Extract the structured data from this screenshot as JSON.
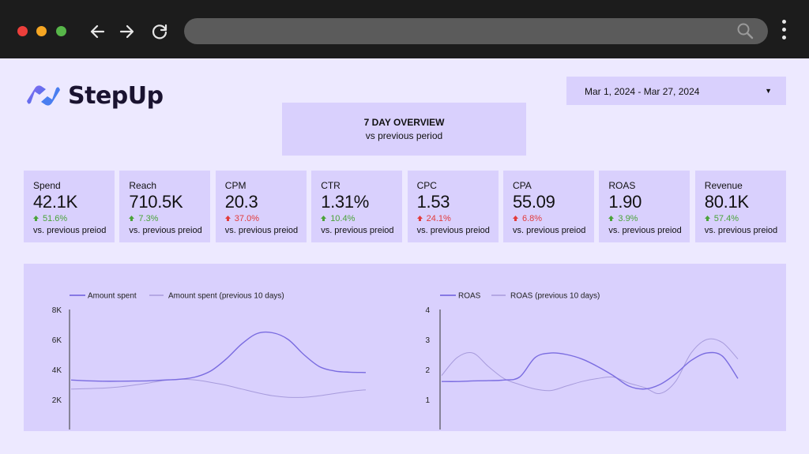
{
  "browser": {
    "icons": [
      "arrow-left-icon",
      "arrow-right-icon",
      "reload-icon",
      "search-icon",
      "kebab-menu-icon"
    ]
  },
  "brand": {
    "name": "StepUp"
  },
  "overview": {
    "title": "7 DAY OVERVIEW",
    "subtitle": "vs previous period"
  },
  "date_range": {
    "value": "Mar 1, 2024 - Mar 27, 2024",
    "arrow": "▼"
  },
  "colors": {
    "accent": "#7a6ce0",
    "panel": "#d9d0fd",
    "background": "#ede9ff",
    "up": "#4aa33a",
    "down": "#e23b3b"
  },
  "kpis": [
    {
      "label": "Spend",
      "value": "42.1K",
      "delta": "51.6%",
      "direction": "up",
      "sub": "vs. previous preiod"
    },
    {
      "label": "Reach",
      "value": "710.5K",
      "delta": "7.3%",
      "direction": "up",
      "sub": "vs. previous preiod"
    },
    {
      "label": "CPM",
      "value": "20.3",
      "delta": "37.0%",
      "direction": "down",
      "sub": "vs. previous preiod"
    },
    {
      "label": "CTR",
      "value": "1.31%",
      "delta": "10.4%",
      "direction": "up",
      "sub": "vs. previous preiod"
    },
    {
      "label": "CPC",
      "value": "1.53",
      "delta": "24.1%",
      "direction": "down",
      "sub": "vs. previous preiod"
    },
    {
      "label": "CPA",
      "value": "55.09",
      "delta": "6.8%",
      "direction": "down",
      "sub": "vs. previous preiod"
    },
    {
      "label": "ROAS",
      "value": "1.90",
      "delta": "3.9%",
      "direction": "up",
      "sub": "vs. previous preiod"
    },
    {
      "label": "Revenue",
      "value": "80.1K",
      "delta": "57.4%",
      "direction": "up",
      "sub": "vs. previous preiod"
    }
  ],
  "chart_data": [
    {
      "type": "line",
      "ylim": [
        0,
        8000
      ],
      "yticks": [
        "2K",
        "4K",
        "6K",
        "8K"
      ],
      "ytick_values": [
        2000,
        4000,
        6000,
        8000
      ],
      "x": [
        1,
        2,
        3,
        4,
        5,
        6,
        7,
        8,
        9,
        10,
        11,
        12,
        13,
        14,
        15,
        16,
        17,
        18,
        19,
        20
      ],
      "series": [
        {
          "name": "Amount spent",
          "values": [
            3300,
            3250,
            3220,
            3220,
            3230,
            3250,
            3300,
            3350,
            3500,
            3900,
            4700,
            5700,
            6400,
            6450,
            6000,
            5000,
            4200,
            3900,
            3820,
            3800
          ],
          "color": "#7a6ce0",
          "width": 1.4
        },
        {
          "name": "Amount spent  (previous 10 days)",
          "values": [
            2700,
            2720,
            2760,
            2830,
            2950,
            3100,
            3270,
            3350,
            3300,
            3150,
            2950,
            2700,
            2450,
            2250,
            2150,
            2150,
            2250,
            2400,
            2550,
            2650
          ],
          "color": "#a79bdc",
          "width": 1
        }
      ]
    },
    {
      "type": "line",
      "ylim": [
        0,
        4
      ],
      "yticks": [
        "1",
        "2",
        "3",
        "4"
      ],
      "ytick_values": [
        1,
        2,
        3,
        4
      ],
      "x": [
        1,
        2,
        3,
        4,
        5,
        6,
        7,
        8,
        9,
        10,
        11,
        12,
        13,
        14,
        15,
        16,
        17,
        18,
        19,
        20
      ],
      "series": [
        {
          "name": "ROAS",
          "values": [
            1.6,
            1.6,
            1.62,
            1.63,
            1.65,
            1.75,
            2.4,
            2.55,
            2.5,
            2.35,
            2.1,
            1.8,
            1.45,
            1.35,
            1.5,
            1.85,
            2.3,
            2.55,
            2.45,
            1.7
          ],
          "color": "#7a6ce0",
          "width": 1.4
        },
        {
          "name": "ROAS (previous 10 days)",
          "values": [
            1.8,
            2.4,
            2.55,
            2.1,
            1.7,
            1.5,
            1.35,
            1.3,
            1.45,
            1.6,
            1.7,
            1.75,
            1.55,
            1.4,
            1.2,
            1.6,
            2.55,
            3.0,
            2.9,
            2.35
          ],
          "color": "#a79bdc",
          "width": 1
        }
      ]
    }
  ]
}
